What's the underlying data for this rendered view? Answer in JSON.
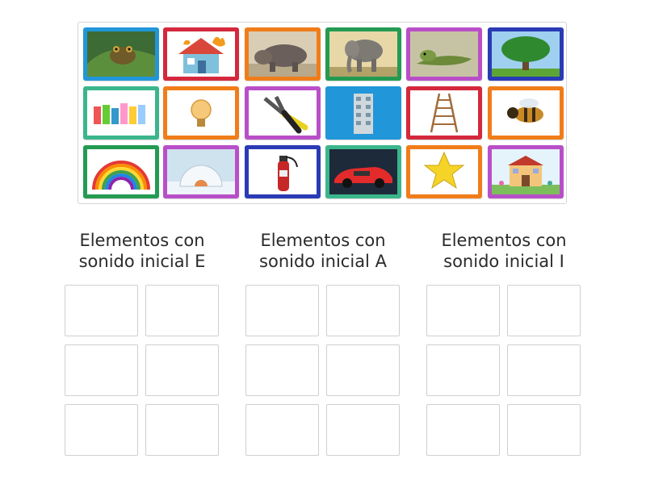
{
  "colors": {
    "blue": "#2196d9",
    "red": "#d4283c",
    "orange": "#f07d1a",
    "green": "#239b52",
    "magenta": "#b94fc8",
    "navy": "#2a3bb5",
    "teal": "#3bb58c",
    "tray_border": "#d4d4d4",
    "slot_border": "#cfcfcf",
    "heading": "#2b2b2b"
  },
  "tiles": [
    {
      "name": "frog-image",
      "border": "blue"
    },
    {
      "name": "burning-house-image",
      "border": "red"
    },
    {
      "name": "hippo-image",
      "border": "orange"
    },
    {
      "name": "elephant-image",
      "border": "green"
    },
    {
      "name": "iguana-image",
      "border": "magenta"
    },
    {
      "name": "tree-image",
      "border": "navy"
    },
    {
      "name": "thread-spools-image",
      "border": "teal"
    },
    {
      "name": "lightbulb-image",
      "border": "orange"
    },
    {
      "name": "pliers-image",
      "border": "magenta"
    },
    {
      "name": "building-image",
      "border": "blue"
    },
    {
      "name": "ladder-image",
      "border": "red"
    },
    {
      "name": "bee-image",
      "border": "orange"
    },
    {
      "name": "rainbow-image",
      "border": "green"
    },
    {
      "name": "igloo-image",
      "border": "magenta"
    },
    {
      "name": "fire-extinguisher-image",
      "border": "navy"
    },
    {
      "name": "car-image",
      "border": "teal"
    },
    {
      "name": "star-image",
      "border": "orange"
    },
    {
      "name": "school-image",
      "border": "magenta"
    }
  ],
  "groups": [
    {
      "line1": "Elementos con",
      "line2": "sonido inicial E"
    },
    {
      "line1": "Elementos con",
      "line2": "sonido inicial A"
    },
    {
      "line1": "Elementos con",
      "line2": "sonido inicial I"
    }
  ]
}
